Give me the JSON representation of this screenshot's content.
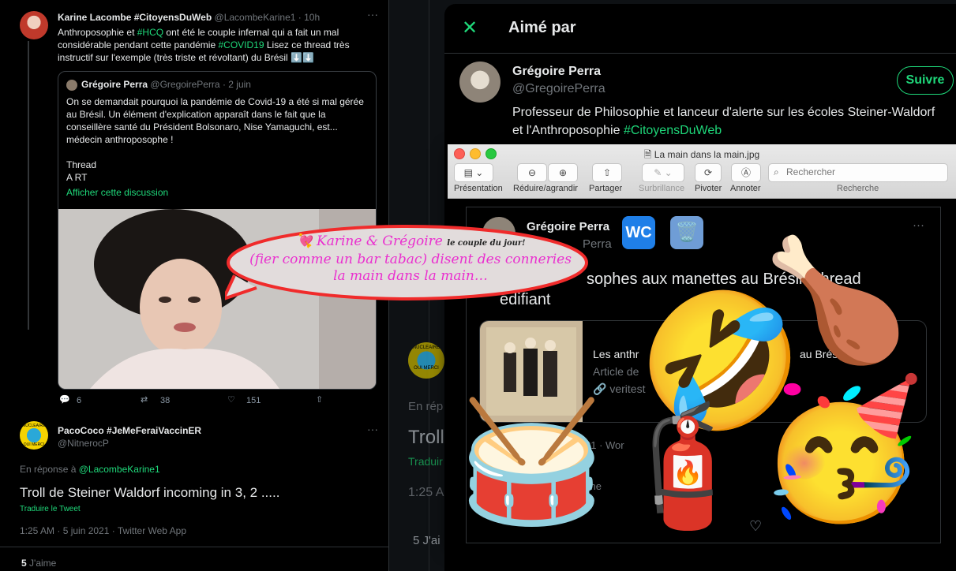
{
  "left": {
    "tweet1": {
      "name": "Karine Lacombe #CitoyensDuWeb",
      "handle": "@LacombeKarine1",
      "time": "· 10h",
      "text_a": "Anthroposophie et ",
      "tag1": "#HCQ",
      "text_b": " ont été le couple infernal qui a fait un mal considérable pendant cette pandémie ",
      "tag2": "#COVID19",
      "text_c": " Lisez ce thread très instructif sur l'exemple (très triste et révoltant) du Brésil ⬇️⬇️",
      "quote": {
        "name": "Grégoire Perra",
        "handle": "@GregoirePerra",
        "time": "· 2 juin",
        "text": "On se demandait pourquoi la pandémie de Covid-19 a été si mal gérée au Brésil. Un élément d'explication apparaît dans le fait que la conseillère santé du Président Bolsonaro, Nise Yamaguchi, est... médecin anthroposophe !",
        "thread": "Thread",
        "art": "A RT",
        "show": "Afficher cette discussion"
      },
      "replies": "6",
      "retweets": "38",
      "likes": "151"
    },
    "tweet2": {
      "name": "PacoCoco #JeMeFeraiVaccinER",
      "handle": "@NitnerocP",
      "reply_to": "En réponse à ",
      "reply_handle": "@LacombeKarine1",
      "text": "Troll de Steiner Waldorf incoming in 3, 2 .....",
      "translate": "Traduire le Tweet",
      "meta": "1:25 AM · 5 juin 2021 · Twitter Web App",
      "likes_count": "5",
      "likes_label": " J'aime",
      "badge_top": "NUCLEAIRE",
      "badge_bottom": "OUI MERCI"
    }
  },
  "mid": {
    "reply_prefix": "En rép",
    "troll": "Troll",
    "translate": "Traduir",
    "time": "1:25 A",
    "likes": "5 J'ai",
    "badge_top": "NUCLEAIRE",
    "badge_bottom": "OUI MERCI"
  },
  "modal": {
    "title": "Aimé par",
    "user": {
      "name": "Grégoire Perra",
      "handle": "@GregoirePerra",
      "follow": "Suivre",
      "bio": "Professeur de Philosophie et lanceur d'alerte sur les écoles Steiner-Waldorf et l'Anthroposophie ",
      "bio_tag": "#CitoyensDuWeb"
    }
  },
  "preview": {
    "filename": "La main dans la main.jpg",
    "toolbar": {
      "presentation": "Présentation",
      "zoom": "Réduire/agrandir",
      "share": "Partager",
      "brightness": "Surbrillance",
      "rotate": "Pivoter",
      "annotate": "Annoter",
      "search_placeholder": "Rechercher",
      "search_label": "Recherche"
    },
    "tweet": {
      "name": "Grégoire Perra",
      "handle_frag": "Perra",
      "text_frag": "sophes aux manettes au Brésil. Thread",
      "text_frag2": "édifiant",
      "card_title": "Les anthr",
      "card_title2": "au Brésil",
      "card_sub": "Article de",
      "card_link": "veritest",
      "meta_frag": "21 · Wor",
      "likes_frag": "ime"
    }
  },
  "bubble": {
    "line1": "Karine & Grégoire",
    "small": "le couple du jour!",
    "line2": "(fier comme un bar tabac) disent des conneries",
    "line3": "la main dans la main…",
    "heart": "💘"
  },
  "stickers": {
    "wc": "WC",
    "trash": "🗑️",
    "leg": "🍗",
    "rofl": "🤣",
    "party": "🥳",
    "drum": "🥁",
    "extinguisher": "🧯"
  }
}
